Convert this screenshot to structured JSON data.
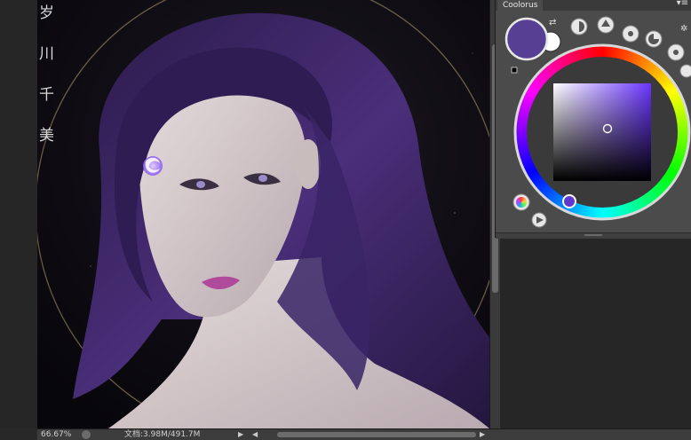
{
  "panel": {
    "title": "Coolorus",
    "menu_glyph": "▾≡",
    "current_color": "#574093",
    "background_color": "#ffffff",
    "icons": [
      "swap-colors-icon",
      "triangle-mode-icon",
      "brightness-icon",
      "palette-icon",
      "color-history-icon",
      "settings-gear-icon",
      "color-wheel-mode-icon",
      "play-icon"
    ]
  },
  "canvas": {
    "vertical_text": [
      "岁",
      "川",
      "千",
      "美"
    ],
    "forehead_mark_color": "#9b6bff",
    "hair_color": "#3a2560",
    "skin_color": "#dcd4d4"
  },
  "status": {
    "zoom": "66.67%",
    "doc_info": "文档:3.98M/491.7M",
    "arrow": "▶",
    "scroll_left": "◀",
    "scroll_right": "▶"
  }
}
